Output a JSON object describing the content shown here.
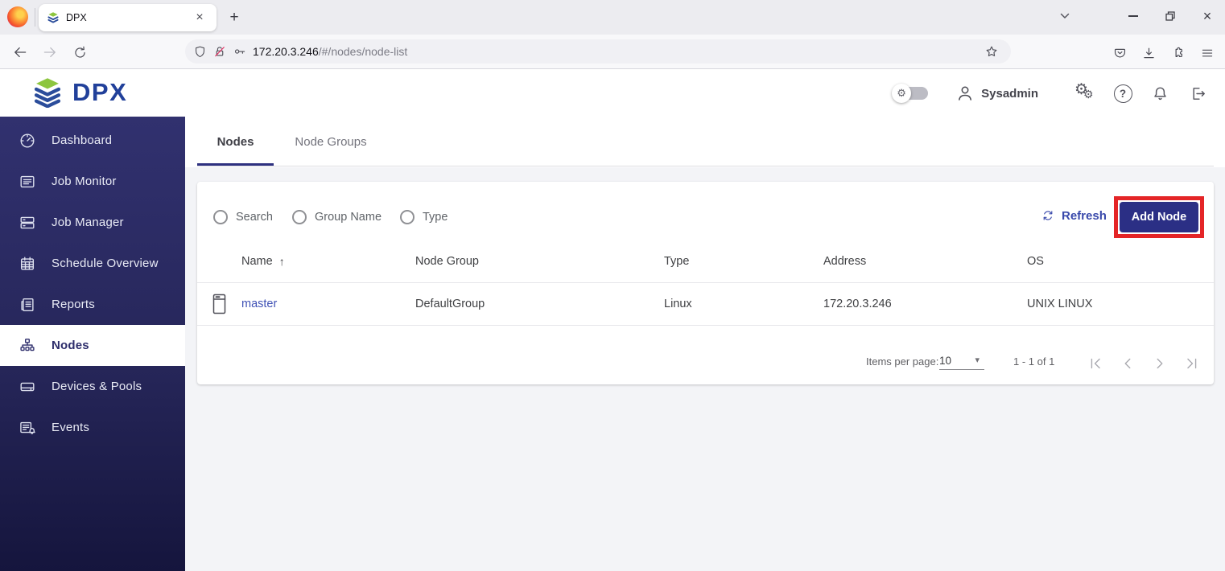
{
  "browser": {
    "tab_title": "DPX",
    "url_domain": "172.20.3.246",
    "url_path": "/#/nodes/node-list"
  },
  "header": {
    "logo_text": "DPX",
    "username": "Sysadmin"
  },
  "sidebar": {
    "items": [
      {
        "label": "Dashboard",
        "icon": "gauge-icon"
      },
      {
        "label": "Job Monitor",
        "icon": "list-panel-icon"
      },
      {
        "label": "Job Manager",
        "icon": "stacked-jobs-icon"
      },
      {
        "label": "Schedule Overview",
        "icon": "calendar-icon"
      },
      {
        "label": "Reports",
        "icon": "report-doc-icon"
      },
      {
        "label": "Nodes",
        "icon": "hierarchy-icon",
        "active": true
      },
      {
        "label": "Devices & Pools",
        "icon": "storage-drive-icon"
      },
      {
        "label": "Events",
        "icon": "event-bell-icon"
      }
    ]
  },
  "main": {
    "tabs": [
      {
        "label": "Nodes",
        "active": true
      },
      {
        "label": "Node Groups",
        "active": false
      }
    ],
    "filters": [
      {
        "label": "Search",
        "selected": false
      },
      {
        "label": "Group Name",
        "selected": false
      },
      {
        "label": "Type",
        "selected": false
      }
    ],
    "toolbar": {
      "refresh_label": "Refresh",
      "add_node_label": "Add Node"
    },
    "table": {
      "columns": [
        "Name",
        "Node Group",
        "Type",
        "Address",
        "OS"
      ],
      "sort": {
        "column": "Name",
        "direction": "asc"
      },
      "rows": [
        {
          "name": "master",
          "node_group": "DefaultGroup",
          "type": "Linux",
          "address": "172.20.3.246",
          "os": "UNIX LINUX"
        }
      ]
    },
    "pagination": {
      "items_per_page_label": "Items per page:",
      "items_per_page": "10",
      "range_label": "1 - 1 of 1"
    }
  },
  "glyphs": {
    "close": "×",
    "new_tab": "+",
    "help": "?",
    "gear": "⚙",
    "sort_asc": "↑",
    "caret": "▾"
  },
  "colors": {
    "accent_navy": "#2b2f85",
    "annotation_red": "#e42527",
    "link_indigo": "#3f51b5",
    "logo_blue": "#21409a",
    "logo_green": "#8dc63f",
    "sidebar_top": "#31316f",
    "sidebar_bottom": "#15153d"
  }
}
